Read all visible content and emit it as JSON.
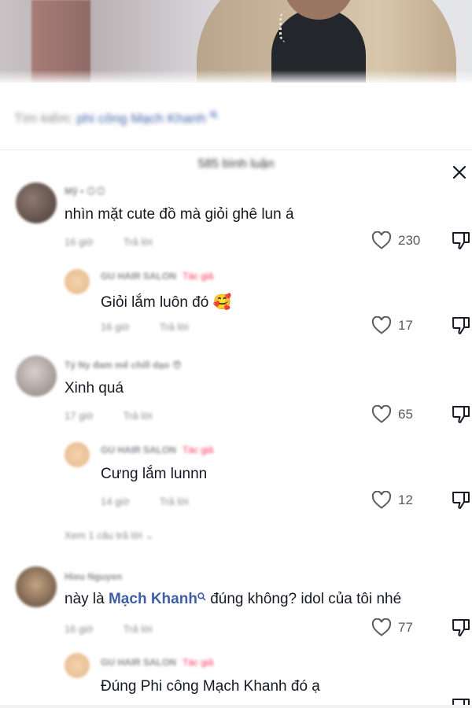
{
  "search": {
    "prefix": "Tìm kiếm:",
    "term": "phi công Mạch Khanh"
  },
  "panel": {
    "title": "585 bình luận"
  },
  "comments": [
    {
      "name": "Mỹ • 😊😊",
      "text": "nhìn mặt cute đồ mà giỏi ghê lun á",
      "time": "16 giờ",
      "reply": "Trả lời",
      "likes": "230",
      "replies": [
        {
          "name": "GU HAIR SALON",
          "tag": "Tác giả",
          "text": "Giỏi lắm luôn đó 🥰",
          "time": "16 giờ",
          "reply": "Trả lời",
          "likes": "17"
        }
      ]
    },
    {
      "name": "Tý Ny đam mê chill dạo",
      "name_emoji": "😎",
      "text": "Xinh quá",
      "time": "17 giờ",
      "reply": "Trả lời",
      "likes": "65",
      "replies": [
        {
          "name": "GU HAIR SALON",
          "tag": "Tác giả",
          "text": "Cưng lắm lunnn",
          "time": "14 giờ",
          "reply": "Trả lời",
          "likes": "12"
        }
      ],
      "view_more": "Xem 1 câu trả lời ⌄"
    },
    {
      "name": "Hieu Nguyen",
      "text_before": "này là",
      "text_link": "Mạch Khanh",
      "text_after": "đúng không? idol của tôi nhé",
      "time": "16 giờ",
      "reply": "Trả lời",
      "likes": "77",
      "replies": [
        {
          "name": "GU HAIR SALON",
          "tag": "Tác giả",
          "text": "Đúng Phi công Mạch Khanh đó ạ",
          "time": "",
          "reply": ""
        }
      ]
    }
  ],
  "icons": {
    "like": "heart-outline-icon",
    "dislike": "thumbs-down-icon",
    "close": "close-icon",
    "search_suffix": "search-icon"
  },
  "colors": {
    "author_tag": "#fe2c55",
    "link": "#3e5fa8",
    "muted": "#8a8b91"
  }
}
